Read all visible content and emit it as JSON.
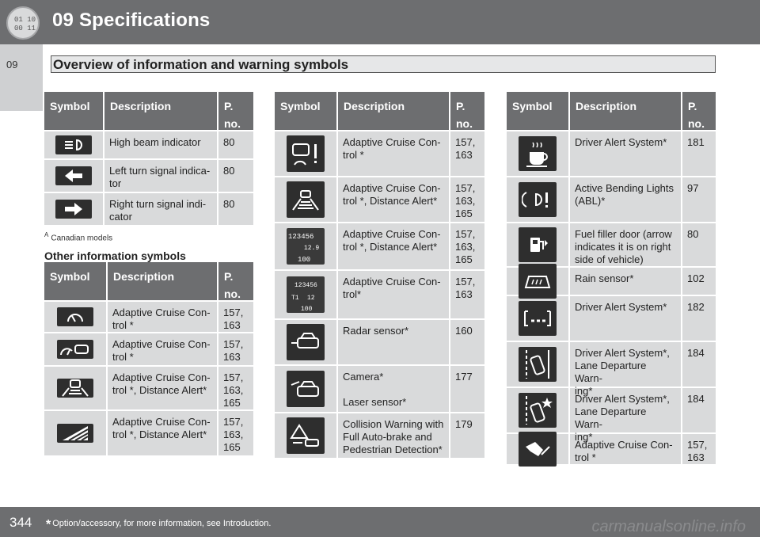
{
  "header": {
    "chapter_title": "09  Specifications",
    "icon_text_top": "01 10",
    "icon_text_bottom": "00 11"
  },
  "sidebar": {
    "chapter": "09"
  },
  "section_title": "Overview of information and warning symbols",
  "columns": {
    "symbol": "Symbol",
    "description": "Description",
    "page": "P.\nno."
  },
  "table1": {
    "rows": [
      {
        "icon": "high-beam-icon",
        "desc": "High beam indicator",
        "page": "80"
      },
      {
        "icon": "left-arrow-icon",
        "desc": "Left turn signal indica-\ntor",
        "page": "80"
      },
      {
        "icon": "right-arrow-icon",
        "desc": "Right turn signal indi-\ncator",
        "page": "80"
      }
    ]
  },
  "canadian_note": {
    "mark": "A",
    "text": "Canadian models"
  },
  "other_heading": "Other information symbols",
  "table2": {
    "rows": [
      {
        "icon": "speedometer-icon",
        "desc": "Adaptive Cruise Con-\ntrol *",
        "page": "157,\n163"
      },
      {
        "icon": "cruise-car-icon",
        "desc": "Adaptive Cruise Con-\ntrol *",
        "page": "157,\n163"
      },
      {
        "icon": "distance-alert-car-icon",
        "desc": "Adaptive Cruise Con-\ntrol *, Distance Alert*",
        "page": "157,\n163,\n165"
      },
      {
        "icon": "distance-bars-icon",
        "desc": "Adaptive Cruise Con-\ntrol *, Distance Alert*",
        "page": "157,\n163,\n165"
      }
    ]
  },
  "table3": {
    "rows": [
      {
        "icon": "cruise-warning-icon",
        "desc": "Adaptive Cruise Con-\ntrol *",
        "page": "157,\n163"
      },
      {
        "icon": "road-car-icon",
        "desc": "Adaptive Cruise Con-\ntrol *, Distance Alert*",
        "page": "157,\n163,\n165"
      },
      {
        "icon": "display-odometer-icon",
        "desc": "Adaptive Cruise Con-\ntrol *, Distance Alert*",
        "page": "157,\n163,\n165",
        "display": [
          "123456",
          "12.9",
          "100"
        ]
      },
      {
        "icon": "display-trip-icon",
        "desc": "Adaptive Cruise Con-\ntrol*",
        "page": "157,\n163",
        "display": [
          "123456",
          "T1",
          "12",
          "100"
        ]
      },
      {
        "icon": "radar-car-icon",
        "desc": "Radar sensor*",
        "page": "160"
      },
      {
        "icon": "camera-car-icon",
        "desc": "Camera*\n\nLaser sensor*",
        "page": "177"
      },
      {
        "icon": "collision-warning-icon",
        "desc": "Collision Warning with\nFull Auto-brake and\nPedestrian Detection*",
        "page": "179"
      }
    ]
  },
  "table4": {
    "rows": [
      {
        "icon": "coffee-cup-icon",
        "desc": "Driver Alert System*",
        "page": "181"
      },
      {
        "icon": "bending-lights-icon",
        "desc": "Active Bending Lights\n(ABL)*",
        "page": "97"
      },
      {
        "icon": "fuel-door-icon",
        "desc": "Fuel filler door (arrow\nindicates it is on right\nside of vehicle)",
        "page": "80"
      },
      {
        "icon": "rain-sensor-icon",
        "desc": "Rain sensor*",
        "page": "102"
      },
      {
        "icon": "driver-alert-bars-icon",
        "desc": "Driver Alert System*",
        "page": "182"
      },
      {
        "icon": "lane-departure-icon",
        "desc": "Driver Alert System*,\nLane Departure Warn-\ning*",
        "page": "184"
      },
      {
        "icon": "lane-departure-star-icon",
        "desc": "Driver Alert System*,\nLane Departure Warn-\ning*",
        "page": "184"
      },
      {
        "icon": "hand-wheel-icon",
        "desc": "Adaptive Cruise Con-\ntrol *",
        "page": "157,\n163"
      }
    ]
  },
  "footer": {
    "page_number": "344",
    "asterisk": "*",
    "note": "Option/accessory, for more information, see Introduction.",
    "watermark": "carmanualsonline.info"
  }
}
